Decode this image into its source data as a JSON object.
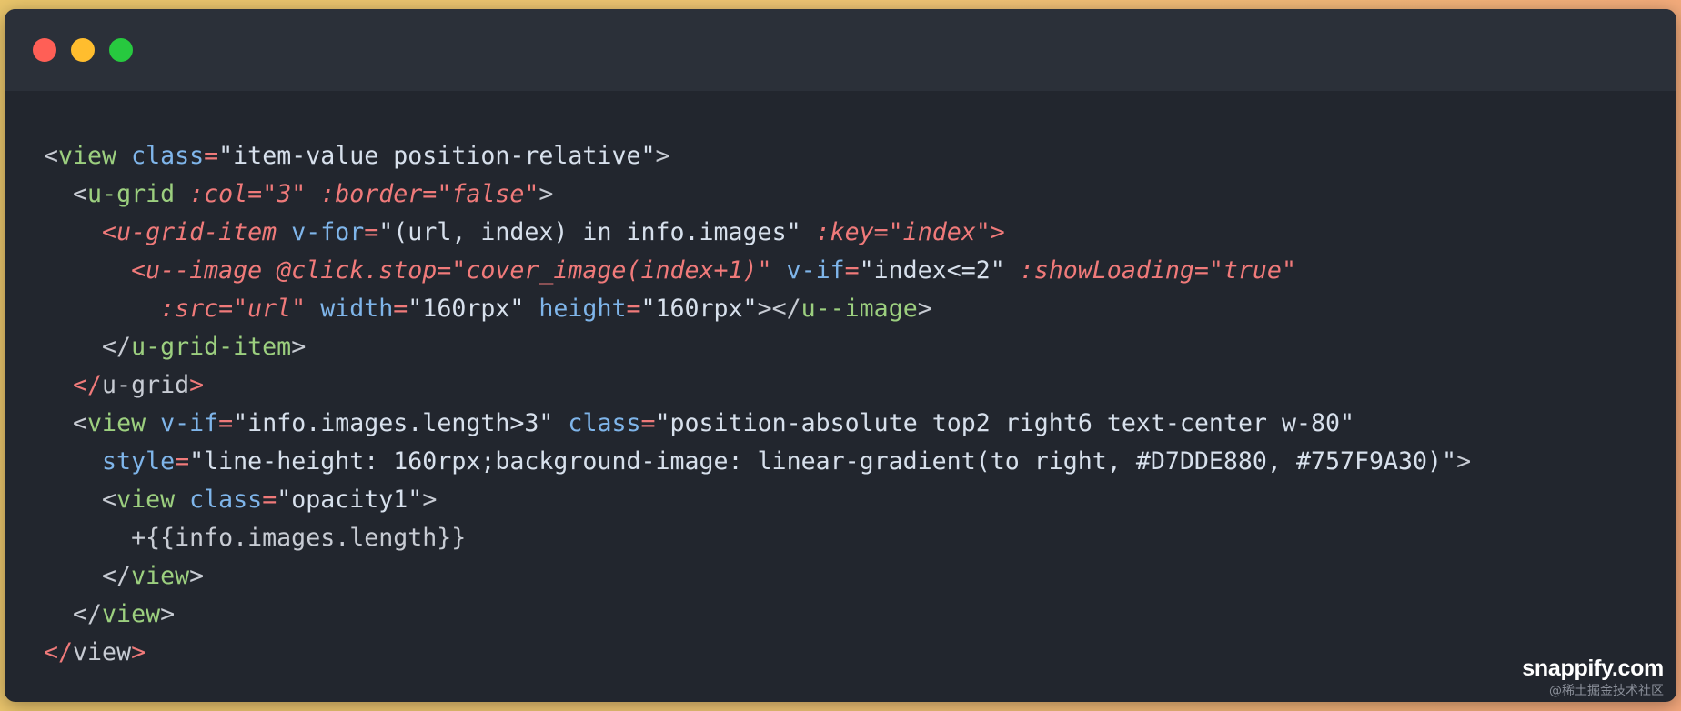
{
  "window": {
    "controls": [
      "close",
      "minimize",
      "maximize"
    ],
    "colors": {
      "close": "#ff5f56",
      "minimize": "#ffbd2e",
      "maximize": "#27c93f"
    }
  },
  "code_lines": [
    [
      [
        "punct",
        "<"
      ],
      [
        "tag",
        "view"
      ],
      [
        "attr",
        " class"
      ],
      [
        "oper",
        "="
      ],
      [
        "str",
        "\"item-value position-relative\""
      ],
      [
        "punct",
        ">"
      ]
    ],
    [
      [
        "punct",
        "  <"
      ],
      [
        "tag",
        "u-grid"
      ],
      [
        "italic",
        " :col=\"3\" :border=\"false\""
      ],
      [
        "punct",
        ">"
      ]
    ],
    [
      [
        "oper",
        "    <"
      ],
      [
        "italic",
        "u-grid-item"
      ],
      [
        "attr",
        " v-for"
      ],
      [
        "oper",
        "="
      ],
      [
        "str",
        "\"(url, index) in info.images\""
      ],
      [
        "italic",
        " :key=\"index\""
      ],
      [
        "oper",
        ">"
      ]
    ],
    [
      [
        "oper",
        "      <"
      ],
      [
        "italic",
        "u--image @click.stop=\"cover_image(index+1)\""
      ],
      [
        "attr",
        " v-if"
      ],
      [
        "oper",
        "="
      ],
      [
        "str",
        "\"index<=2\""
      ],
      [
        "italic",
        " :showLoading=\"true\""
      ]
    ],
    [
      [
        "italic",
        "        :src=\"url\""
      ],
      [
        "attr",
        " width"
      ],
      [
        "oper",
        "="
      ],
      [
        "str",
        "\"160rpx\""
      ],
      [
        "attr",
        " height"
      ],
      [
        "oper",
        "="
      ],
      [
        "str",
        "\"160rpx\""
      ],
      [
        "punct",
        "></"
      ],
      [
        "tag",
        "u--image"
      ],
      [
        "punct",
        ">"
      ]
    ],
    [
      [
        "punct",
        "    </"
      ],
      [
        "tag",
        "u-grid-item"
      ],
      [
        "punct",
        ">"
      ]
    ],
    [
      [
        "oper",
        "  </"
      ],
      [
        "text",
        "u-grid"
      ],
      [
        "oper",
        ">"
      ]
    ],
    [
      [
        "punct",
        "  <"
      ],
      [
        "tag",
        "view"
      ],
      [
        "attr",
        " v-if"
      ],
      [
        "oper",
        "="
      ],
      [
        "str",
        "\"info.images.length>3\""
      ],
      [
        "attr",
        " class"
      ],
      [
        "oper",
        "="
      ],
      [
        "str",
        "\"position-absolute top2 right6 text-center w-80\""
      ]
    ],
    [
      [
        "attr",
        "    style"
      ],
      [
        "oper",
        "="
      ],
      [
        "str",
        "\"line-height: 160rpx;background-image: linear-gradient(to right, #D7DDE880, #757F9A30)\""
      ],
      [
        "punct",
        ">"
      ]
    ],
    [
      [
        "punct",
        "    <"
      ],
      [
        "tag",
        "view"
      ],
      [
        "attr",
        " class"
      ],
      [
        "oper",
        "="
      ],
      [
        "str",
        "\"opacity1\""
      ],
      [
        "punct",
        ">"
      ]
    ],
    [
      [
        "text",
        "      +{{info.images.length}}"
      ]
    ],
    [
      [
        "punct",
        "    </"
      ],
      [
        "tag",
        "view"
      ],
      [
        "punct",
        ">"
      ]
    ],
    [
      [
        "punct",
        "  </"
      ],
      [
        "tag",
        "view"
      ],
      [
        "punct",
        ">"
      ]
    ],
    [
      [
        "oper",
        "</"
      ],
      [
        "text",
        "view"
      ],
      [
        "oper",
        ">"
      ]
    ]
  ],
  "watermark": {
    "brand": "snappify.com",
    "credit": "@稀土掘金技术社区"
  }
}
